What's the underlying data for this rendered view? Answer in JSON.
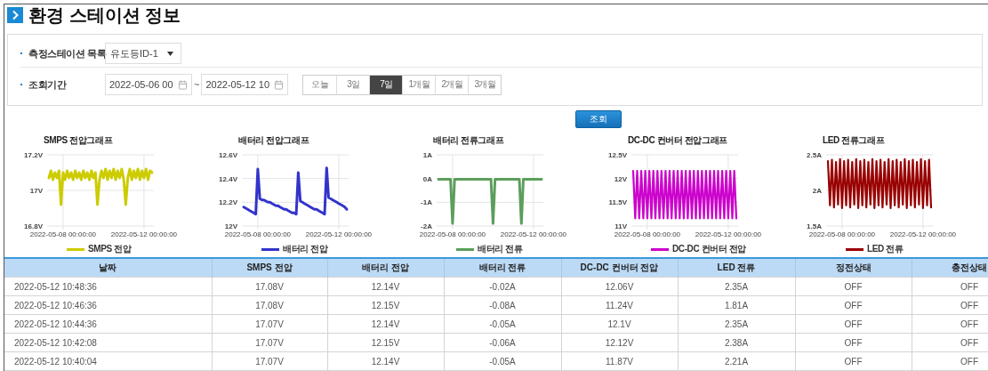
{
  "page": {
    "title": "환경 스테이션 정보"
  },
  "filters": {
    "station": {
      "label": "측정스테이션 목록",
      "value": "유도등ID-1"
    },
    "period": {
      "label": "조회기간",
      "start": "2022-05-06 00",
      "separator": "~",
      "end": "2022-05-12 10",
      "ranges": [
        {
          "label": "오늘",
          "selected": false
        },
        {
          "label": "3일",
          "selected": false
        },
        {
          "label": "7일",
          "selected": true
        },
        {
          "label": "1개월",
          "selected": false
        },
        {
          "label": "2개월",
          "selected": false
        },
        {
          "label": "3개월",
          "selected": false
        }
      ]
    }
  },
  "search_button": "조회",
  "charts": [
    {
      "title": "SMPS 전압그래프",
      "chart_data": {
        "type": "line",
        "ylim": [
          16.8,
          17.2
        ],
        "yticks": [
          {
            "value": 16.8,
            "label": "16.8V"
          },
          {
            "value": 17,
            "label": "17V"
          },
          {
            "value": 17.2,
            "label": "17.2V"
          }
        ],
        "categories": [
          null,
          null,
          null,
          null,
          null,
          null,
          null,
          "2022-05-08 00:00:00",
          null,
          null,
          null,
          null,
          null,
          null,
          null,
          null,
          null,
          null,
          null,
          null,
          null,
          null,
          null,
          null,
          null,
          null,
          null,
          null,
          null,
          null,
          null,
          null,
          null,
          null,
          null,
          null,
          null,
          null,
          null,
          null,
          null,
          null,
          null,
          null,
          null,
          null,
          null,
          "2022-05-12 00:00:00",
          null,
          null,
          null,
          null
        ],
        "series": [
          {
            "name": "SMPS 전압",
            "color": "#cccc00",
            "values": [
              17.07,
              17.11,
              17.06,
              17.1,
              17.07,
              17.11,
              16.92,
              17.1,
              17.06,
              17.11,
              17.07,
              17.1,
              17.06,
              17.11,
              17.07,
              17.1,
              17.06,
              17.11,
              17.07,
              17.1,
              17.06,
              17.11,
              17.07,
              17.1,
              16.92,
              17.06,
              17.11,
              17.07,
              17.12,
              17.06,
              17.11,
              17.07,
              17.12,
              17.06,
              17.11,
              17.07,
              17.12,
              17.06,
              16.92,
              17.07,
              17.12,
              17.06,
              17.11,
              17.07,
              17.12,
              17.06,
              17.11,
              17.07,
              17.12,
              17.06,
              17.11,
              17.1
            ]
          }
        ]
      }
    },
    {
      "title": "배터리 전압그래프",
      "chart_data": {
        "type": "line",
        "ylim": [
          12,
          12.6
        ],
        "yticks": [
          {
            "value": 12,
            "label": "12V"
          },
          {
            "value": 12.2,
            "label": "12.2V"
          },
          {
            "value": 12.4,
            "label": "12.4V"
          },
          {
            "value": 12.6,
            "label": "12.6V"
          }
        ],
        "categories": [
          null,
          null,
          null,
          null,
          null,
          null,
          null,
          "2022-05-08 00:00:00",
          null,
          null,
          null,
          null,
          null,
          null,
          null,
          null,
          null,
          null,
          null,
          null,
          null,
          null,
          null,
          null,
          null,
          null,
          null,
          null,
          null,
          null,
          null,
          null,
          null,
          null,
          null,
          null,
          null,
          null,
          null,
          null,
          null,
          null,
          null,
          null,
          null,
          null,
          null,
          "2022-05-12 00:00:00",
          null,
          null,
          null,
          null
        ],
        "series": [
          {
            "name": "배터리 전압",
            "color": "#3333cc",
            "values": [
              12.16,
              12.15,
              12.14,
              12.13,
              12.12,
              12.11,
              12.1,
              12.48,
              12.23,
              12.22,
              12.22,
              12.21,
              12.2,
              12.2,
              12.19,
              12.18,
              12.17,
              12.17,
              12.16,
              12.15,
              12.14,
              12.14,
              12.13,
              12.12,
              12.11,
              12.11,
              12.1,
              12.45,
              12.21,
              12.2,
              12.19,
              12.18,
              12.17,
              12.16,
              12.15,
              12.14,
              12.14,
              12.13,
              12.12,
              12.11,
              12.1,
              12.49,
              12.24,
              12.23,
              12.22,
              12.21,
              12.2,
              12.19,
              12.18,
              12.17,
              12.16,
              12.14
            ]
          }
        ]
      }
    },
    {
      "title": "배터리 전류그래프",
      "chart_data": {
        "type": "line",
        "ylim": [
          -2,
          1
        ],
        "yticks": [
          {
            "value": -2,
            "label": "-2A"
          },
          {
            "value": -1,
            "label": "-1A"
          },
          {
            "value": 0,
            "label": "0A"
          },
          {
            "value": 1,
            "label": "1A"
          }
        ],
        "categories": [
          null,
          null,
          null,
          null,
          null,
          null,
          null,
          "2022-05-08 00:00:00",
          null,
          null,
          null,
          null,
          null,
          null,
          null,
          null,
          null,
          null,
          null,
          null,
          null,
          null,
          null,
          null,
          null,
          null,
          null,
          null,
          null,
          null,
          null,
          null,
          null,
          null,
          null,
          null,
          null,
          null,
          null,
          null,
          null,
          null,
          null,
          null,
          null,
          null,
          null,
          "2022-05-12 00:00:00",
          null,
          null,
          null,
          null
        ],
        "series": [
          {
            "name": "배터리 전류",
            "color": "#5c9e5c",
            "values": [
              -0.03,
              -0.03,
              -0.03,
              -0.03,
              -0.03,
              -0.03,
              -0.03,
              -1.9,
              -0.03,
              -0.03,
              -0.03,
              -0.03,
              -0.03,
              -0.03,
              -0.03,
              -0.03,
              -0.03,
              -0.03,
              -0.03,
              -0.03,
              -0.03,
              -0.03,
              -0.03,
              -0.03,
              -0.03,
              -0.03,
              -0.03,
              -1.9,
              -0.03,
              -0.03,
              -0.03,
              -0.03,
              -0.03,
              -0.03,
              -0.03,
              -0.03,
              -0.03,
              -0.03,
              -0.03,
              -0.03,
              -0.03,
              -1.9,
              -0.03,
              -0.03,
              -0.03,
              -0.03,
              -0.03,
              -0.03,
              -0.03,
              -0.03,
              -0.03,
              -0.03
            ]
          }
        ]
      }
    },
    {
      "title": "DC-DC 컨버터 전압그래프",
      "chart_data": {
        "type": "line",
        "ylim": [
          11,
          12.5
        ],
        "yticks": [
          {
            "value": 11,
            "label": "11V"
          },
          {
            "value": 11.5,
            "label": "11.5V"
          },
          {
            "value": 12,
            "label": "12V"
          },
          {
            "value": 12.5,
            "label": "12.5V"
          }
        ],
        "categories": [
          null,
          null,
          null,
          null,
          null,
          null,
          null,
          "2022-05-08 00:00:00",
          null,
          null,
          null,
          null,
          null,
          null,
          null,
          null,
          null,
          null,
          null,
          null,
          null,
          null,
          null,
          null,
          null,
          null,
          null,
          null,
          null,
          null,
          null,
          null,
          null,
          null,
          null,
          null,
          null,
          null,
          null,
          null,
          null,
          null,
          null,
          null,
          null,
          null,
          null,
          "2022-05-12 00:00:00",
          null,
          null,
          null,
          null
        ],
        "series": [
          {
            "name": "DC-DC 컨버터 전압",
            "color": "#cc00cc",
            "values": [
              12.16,
              11.16,
              12.16,
              11.16,
              12.16,
              11.16,
              12.16,
              11.16,
              12.16,
              11.16,
              12.16,
              11.16,
              12.16,
              11.16,
              12.16,
              11.16,
              12.16,
              11.16,
              12.16,
              11.16,
              12.16,
              11.16,
              12.16,
              11.16,
              12.16,
              11.16,
              12.16,
              11.16,
              12.16,
              11.16,
              12.16,
              11.16,
              12.16,
              11.16,
              12.16,
              11.16,
              12.16,
              11.16,
              12.16,
              11.16,
              12.16,
              11.16,
              12.16,
              11.16,
              12.16,
              11.16,
              12.16,
              11.16,
              12.16,
              11.16,
              12.16,
              11.16
            ]
          }
        ]
      }
    },
    {
      "title": "LED 전류그래프",
      "chart_data": {
        "type": "line",
        "ylim": [
          1.5,
          2.5
        ],
        "yticks": [
          {
            "value": 1.5,
            "label": "1.5A"
          },
          {
            "value": 2,
            "label": "2A"
          },
          {
            "value": 2.5,
            "label": "2.5A"
          }
        ],
        "categories": [
          null,
          null,
          null,
          null,
          null,
          null,
          null,
          "2022-05-08 00:00:00",
          null,
          null,
          null,
          null,
          null,
          null,
          null,
          null,
          null,
          null,
          null,
          null,
          null,
          null,
          null,
          null,
          null,
          null,
          null,
          null,
          null,
          null,
          null,
          null,
          null,
          null,
          null,
          null,
          null,
          null,
          null,
          null,
          null,
          null,
          null,
          null,
          null,
          null,
          null,
          "2022-05-12 00:00:00",
          null,
          null,
          null,
          null
        ],
        "series": [
          {
            "name": "LED 전류",
            "color": "#990000",
            "values": [
              2.41,
              1.79,
              2.43,
              1.76,
              2.4,
              1.8,
              2.44,
              1.75,
              2.41,
              1.79,
              2.43,
              1.76,
              2.4,
              1.8,
              2.44,
              1.75,
              2.41,
              1.79,
              2.43,
              1.76,
              2.4,
              1.8,
              2.44,
              1.75,
              2.41,
              1.79,
              2.43,
              1.76,
              2.4,
              1.8,
              2.44,
              1.75,
              2.41,
              1.79,
              2.43,
              1.76,
              2.4,
              1.8,
              2.44,
              1.75,
              2.41,
              1.79,
              2.43,
              1.76,
              2.4,
              1.8,
              2.44,
              1.75,
              2.41,
              1.79,
              2.43,
              1.76
            ]
          }
        ]
      }
    }
  ],
  "table": {
    "columns": [
      "날짜",
      "SMPS 전압",
      "배터리 전압",
      "배터리 전류",
      "DC-DC 컨버터 전압",
      "LED 전류",
      "정전상태",
      "충전상태"
    ],
    "rows": [
      [
        "2022-05-12 10:48:36",
        "17.08V",
        "12.14V",
        "-0.02A",
        "12.06V",
        "2.35A",
        "OFF",
        "OFF"
      ],
      [
        "2022-05-12 10:46:36",
        "17.08V",
        "12.15V",
        "-0.08A",
        "11.24V",
        "1.81A",
        "OFF",
        "OFF"
      ],
      [
        "2022-05-12 10:44:36",
        "17.07V",
        "12.14V",
        "-0.05A",
        "12.1V",
        "2.35A",
        "OFF",
        "OFF"
      ],
      [
        "2022-05-12 10:42:08",
        "17.07V",
        "12.15V",
        "-0.06A",
        "12.12V",
        "2.38A",
        "OFF",
        "OFF"
      ],
      [
        "2022-05-12 10:40:04",
        "17.07V",
        "12.14V",
        "-0.05A",
        "11.87V",
        "2.21A",
        "OFF",
        "OFF"
      ]
    ]
  }
}
